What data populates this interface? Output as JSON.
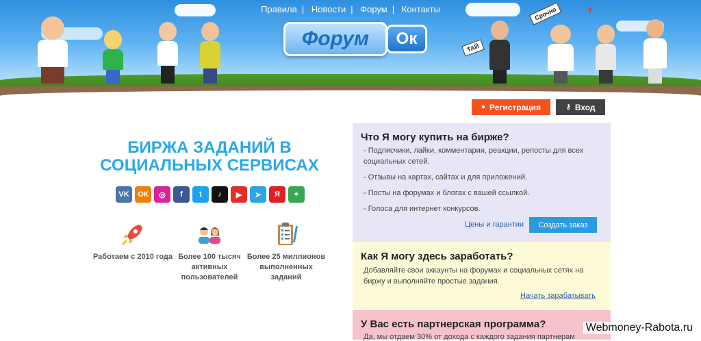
{
  "nav": {
    "items": [
      "Правила",
      "Новости",
      "Форум",
      "Контакты"
    ],
    "separator": "|"
  },
  "logo": {
    "part1": "Форум",
    "part2": "Ок"
  },
  "banner_signs": {
    "left": "Срочно",
    "right": "ТАЙ"
  },
  "auth": {
    "register_label": "Регистрация",
    "login_label": "Вход"
  },
  "hero": {
    "title_line1": "БИРЖА ЗАДАНИЙ В",
    "title_line2": "СОЦИАЛЬНЫХ СЕРВИСАХ"
  },
  "socials": [
    {
      "name": "vk-icon",
      "glyph": "VK",
      "color": "#4a76a8"
    },
    {
      "name": "odnoklassniki-icon",
      "glyph": "ОК",
      "color": "#ee8208"
    },
    {
      "name": "instagram-icon",
      "glyph": "◎",
      "color": "#d6249f"
    },
    {
      "name": "facebook-icon",
      "glyph": "f",
      "color": "#3b5998"
    },
    {
      "name": "twitter-icon",
      "glyph": "t",
      "color": "#1da1f2"
    },
    {
      "name": "tiktok-icon",
      "glyph": "♪",
      "color": "#111111"
    },
    {
      "name": "youtube-icon",
      "glyph": "▶",
      "color": "#e52d27"
    },
    {
      "name": "telegram-icon",
      "glyph": "➤",
      "color": "#2ca5e0"
    },
    {
      "name": "yandex-icon",
      "glyph": "Я",
      "color": "#e31e24"
    },
    {
      "name": "google-maps-icon",
      "glyph": "⌖",
      "color": "#34a853"
    }
  ],
  "features": [
    {
      "icon": "rocket-icon",
      "text": "Работаем с 2010 года"
    },
    {
      "icon": "users-icon",
      "text": "Более 100 тысяч активных пользователей"
    },
    {
      "icon": "clipboard-icon",
      "text": "Более 25 миллионов выполненных заданий"
    }
  ],
  "buy_box": {
    "title": "Что Я могу купить на бирже?",
    "items": [
      "- Подписчики, лайки, комментарии, реакции, репосты для всех социальных сетей.",
      "- Отзывы на картах, сайтах и для приложений.",
      "- Посты на форумах и блогах с вашей ссылкой.",
      "- Голоса для интернет конкурсов."
    ],
    "link": "Цены и гарантии",
    "button": "Создать заказ"
  },
  "earn_box": {
    "title": "Как Я могу здесь заработать?",
    "text": "Добавляйте свои аккаунты на форумах и социальных сетях на биржу и выполняйте простые задания.",
    "link": "Начать зарабатывать"
  },
  "partner_box": {
    "title": "У Вас есть партнерская программа?",
    "text": "Да, мы отдаем 30% от дохода с каждого задания партнерам"
  },
  "watermark": "Webmoney-Rabota.ru",
  "colors": {
    "accent": "#29a8e8",
    "register": "#f4511e",
    "login": "#424242",
    "order": "#2b9ae0"
  }
}
